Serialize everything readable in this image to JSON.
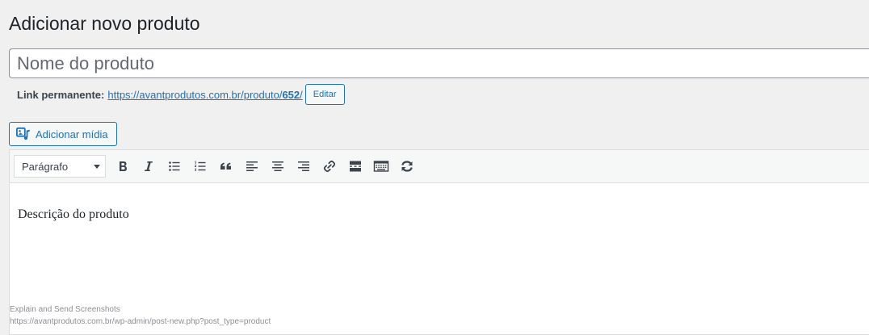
{
  "page": {
    "title": "Adicionar novo produto"
  },
  "title_field": {
    "placeholder": "Nome do produto"
  },
  "permalink": {
    "label": "Link permanente:",
    "url_prefix": "https://avantprodutos.com.br/produto/",
    "url_id": "652",
    "url_suffix": "/",
    "edit_label": "Editar"
  },
  "media": {
    "add_label": "Adicionar mídia",
    "icon": "media-icon"
  },
  "toolbar": {
    "format_value": "Parágrafo",
    "buttons": [
      {
        "name": "bold",
        "icon": "bold-icon"
      },
      {
        "name": "italic",
        "icon": "italic-icon"
      },
      {
        "name": "bulleted-list",
        "icon": "bulleted-list-icon"
      },
      {
        "name": "numbered-list",
        "icon": "numbered-list-icon"
      },
      {
        "name": "blockquote",
        "icon": "quote-icon"
      },
      {
        "name": "align-left",
        "icon": "align-left-icon"
      },
      {
        "name": "align-center",
        "icon": "align-center-icon"
      },
      {
        "name": "align-right",
        "icon": "align-right-icon"
      },
      {
        "name": "insert-link",
        "icon": "link-icon"
      },
      {
        "name": "read-more",
        "icon": "read-more-icon"
      },
      {
        "name": "toolbar-toggle",
        "icon": "keyboard-icon"
      },
      {
        "name": "sync",
        "icon": "sync-icon"
      }
    ]
  },
  "editor": {
    "content": "Descrição do produto"
  },
  "status_overlay": {
    "line1": "Explain and Send Screenshots",
    "line2": "https://avantprodutos.com.br/wp-admin/post-new.php?post_type=product"
  },
  "colors": {
    "accent": "#2271b1",
    "background": "#f0f0f1",
    "text": "#1d2327",
    "icon": "#3c434a"
  }
}
